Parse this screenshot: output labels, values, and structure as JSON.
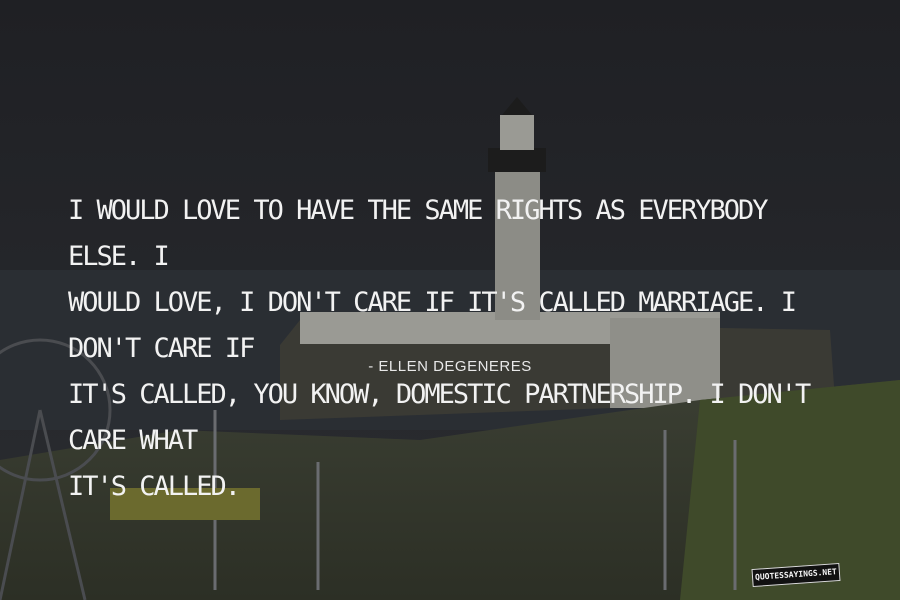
{
  "quote": {
    "lines": [
      "I WOULD LOVE TO HAVE THE SAME RIGHTS AS EVERYBODY ELSE. I",
      "WOULD LOVE, I DON'T CARE IF IT'S CALLED MARRIAGE. I DON'T CARE IF",
      "IT'S CALLED, YOU KNOW, DOMESTIC PARTNERSHIP. I DON'T CARE WHAT",
      "IT'S CALLED."
    ],
    "author": "- ELLEN DEGENERES"
  },
  "watermark": "QUOTESSAYINGS.NET",
  "background": {
    "description_icon": "lighthouse-fort-icon",
    "sky_color": "#222327",
    "sea_color": "#2a2e33",
    "grass_color": "#3f4a2a"
  }
}
